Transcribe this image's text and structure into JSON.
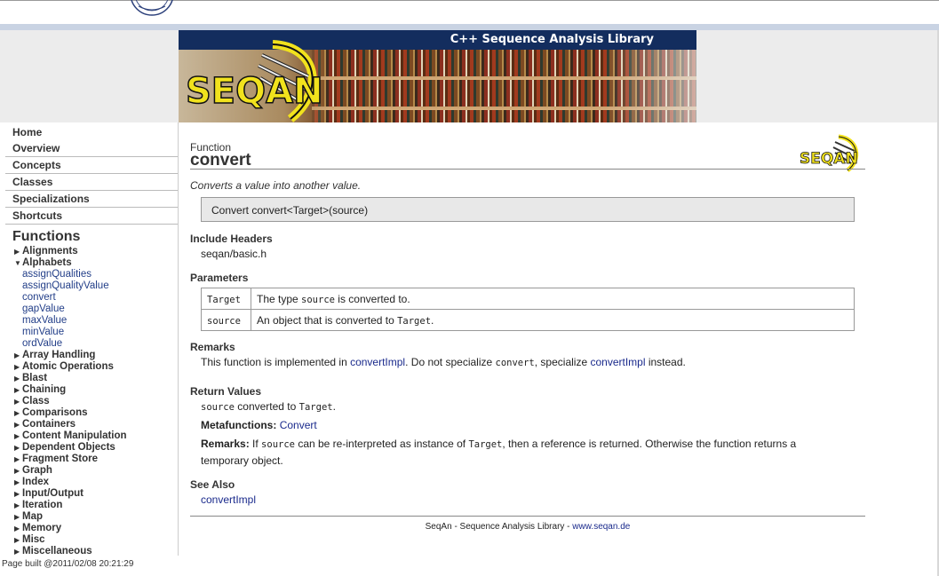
{
  "banner": {
    "title": "C++ Sequence Analysis Library",
    "logo_text": "SEQAN"
  },
  "nav": {
    "links": [
      "Home",
      "Overview",
      "Concepts",
      "Classes",
      "Specializations",
      "Shortcuts"
    ],
    "functions_title": "Functions",
    "functions": [
      {
        "label": "Alignments",
        "expanded": false
      },
      {
        "label": "Alphabets",
        "expanded": true,
        "children": [
          "assignQualities",
          "assignQualityValue",
          "convert",
          "gapValue",
          "maxValue",
          "minValue",
          "ordValue"
        ]
      },
      {
        "label": "Array Handling",
        "expanded": false
      },
      {
        "label": "Atomic Operations",
        "expanded": false
      },
      {
        "label": "Blast",
        "expanded": false
      },
      {
        "label": "Chaining",
        "expanded": false
      },
      {
        "label": "Class",
        "expanded": false
      },
      {
        "label": "Comparisons",
        "expanded": false
      },
      {
        "label": "Containers",
        "expanded": false
      },
      {
        "label": "Content Manipulation",
        "expanded": false
      },
      {
        "label": "Dependent Objects",
        "expanded": false
      },
      {
        "label": "Fragment Store",
        "expanded": false
      },
      {
        "label": "Graph",
        "expanded": false
      },
      {
        "label": "Index",
        "expanded": false
      },
      {
        "label": "Input/Output",
        "expanded": false
      },
      {
        "label": "Iteration",
        "expanded": false
      },
      {
        "label": "Map",
        "expanded": false
      },
      {
        "label": "Memory",
        "expanded": false
      },
      {
        "label": "Misc",
        "expanded": false
      },
      {
        "label": "Miscellaneous",
        "expanded": false
      }
    ]
  },
  "page": {
    "kind": "Function",
    "name": "convert",
    "small_logo_text": "SEQAN",
    "summary": "Converts a value into another value.",
    "signature": "Convert convert<Target>(source)",
    "include_headers_heading": "Include Headers",
    "include_header": "seqan/basic.h",
    "parameters_heading": "Parameters",
    "parameters": [
      {
        "name": "Target",
        "desc_pre": "The type ",
        "desc_code": "source",
        "desc_post": " is converted to."
      },
      {
        "name": "source",
        "desc_pre": "An object that is converted to ",
        "desc_code": "Target",
        "desc_post": "."
      }
    ],
    "remarks_heading": "Remarks",
    "remarks": {
      "t1": "This function is implemented in ",
      "link1": "convertImpl",
      "t2": ". Do not specialize ",
      "code1": "convert",
      "t3": ", specialize ",
      "link2": "convertImpl",
      "t4": " instead."
    },
    "return_heading": "Return Values",
    "return": {
      "code1": "source",
      "t1": " converted to ",
      "code2": "Target",
      "t2": ".",
      "metafunctions_label": "Metafunctions:",
      "metafunctions_link": "Convert",
      "remarks_label": "Remarks:",
      "r1": " If ",
      "rcode1": "source",
      "r2": " can be re-interpreted as instance of ",
      "rcode2": "Target",
      "r3": ", then a reference is returned. Otherwise the function returns a",
      "r4": "temporary object."
    },
    "see_also_heading": "See Also",
    "see_also_link": "convertImpl",
    "footer_text": "SeqAn - Sequence Analysis Library - ",
    "footer_link": "www.seqan.de"
  },
  "status": {
    "built": "Page built @2011/02/08 20:21:29"
  },
  "colors": {
    "banner_title_bg": "#132d5e",
    "link": "#1a2a8c",
    "logo_yellow": "#f1e21d"
  }
}
